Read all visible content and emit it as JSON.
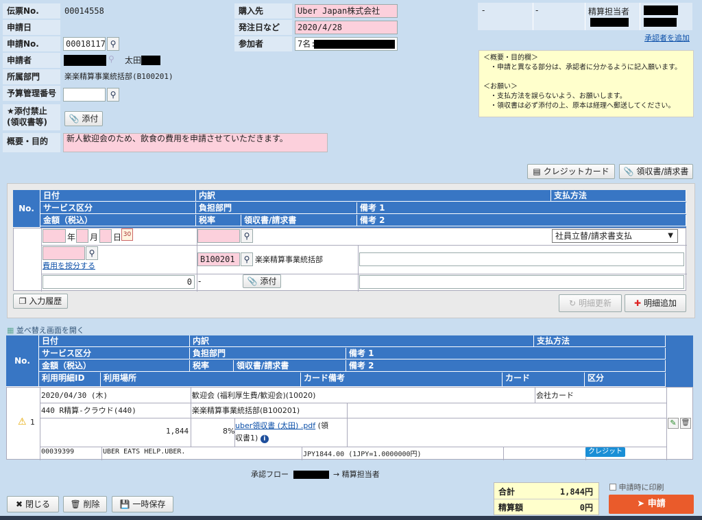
{
  "header": {
    "denpyo_label": "伝票No.",
    "denpyo_value": "00014558",
    "shinseibi_label": "申請日",
    "shinsei_no_label": "申請No.",
    "shinsei_no_value": "00018117",
    "shinseisha_label": "申請者",
    "shinseisha_name": "太田",
    "busho_label": "所属部門",
    "busho_value": "楽楽精算事業統括部(B100201)",
    "yosan_label": "予算管理番号",
    "tenpu_label_1": "★添付禁止",
    "tenpu_label_2": "(領収書等)",
    "tenpu_button": "添付",
    "gaiyo_label": "概要・目的",
    "gaiyo_value": "新人歓迎会のため、飲食の費用を申請させていただきます。",
    "konyusaki_label": "購入先",
    "konyusaki_value": "Uber Japan株式会社",
    "hacchubi_label": "発注日など",
    "hacchubi_value": "2020/4/28",
    "sankasha_label": "参加者",
    "sankasha_value": "7名:"
  },
  "approval": {
    "col1": "-",
    "col2": "-",
    "seisan_tanto": "精算担当者",
    "add_approver": "承認者を追加"
  },
  "notes": {
    "text": "＜概要・目的欄＞\n　・申請と異なる部分は、承認者に分かるように記入願います。\n\n＜お願い＞\n　・支払方法を誤らないよう、お願いします。\n　・領収書は必ず添付の上、原本は経理へ郵送してください。"
  },
  "top_buttons": {
    "credit_card": "クレジットカード",
    "receipt": "領収書/請求書"
  },
  "entry_table": {
    "no": "No.",
    "h_date": "日付",
    "h_service": "サービス区分",
    "h_amount": "金額（税込）",
    "h_uchiwake": "内訳",
    "h_futan": "負担部門",
    "h_zeiritsu": "税率",
    "h_ryoshusho": "領収書/請求書",
    "h_biko1": "備考 1",
    "h_biko2": "備考 2",
    "h_shiharai": "支払方法",
    "year_label": "年",
    "month_label": "月",
    "day_label": "日",
    "calendar": "30",
    "shiharai_value": "社員立替/請求書支払",
    "anbun_link": "費用を按分する",
    "futan_code": "B100201",
    "futan_name": "楽楽精算事業統括部",
    "amount_value": "0",
    "zeiritsu_value": "-",
    "tenpu_button": "添付",
    "history_button": "入力履歴",
    "update_button": "明細更新",
    "add_button": "明細追加"
  },
  "sort_link": "並べ替え画面を開く",
  "list_table": {
    "no": "No.",
    "h_date": "日付",
    "h_service": "サービス区分",
    "h_amount": "金額（税込）",
    "h_meisai_id": "利用明細ID",
    "h_basho": "利用場所",
    "h_uchiwake": "内訳",
    "h_futan": "負担部門",
    "h_zeiritsu": "税率",
    "h_ryoshusho": "領収書/請求書",
    "h_biko1": "備考 1",
    "h_biko2": "備考 2",
    "h_card_biko": "カード備考",
    "h_shiharai": "支払方法",
    "h_card": "カード",
    "h_kubun": "区分",
    "row": {
      "no": "1",
      "date": "2020/04/30 (木)",
      "uchiwake": "歓迎会 (福利厚生費/歓迎会)(10020)",
      "shiharai": "会社カード",
      "service": "440 R精算-クラウド(440)",
      "futan": "楽楽精算事業統括部(B100201)",
      "amount": "1,844",
      "zeiritsu": "8%",
      "ryoshusho_link": "uber領収書 (太田) .pdf",
      "ryoshusho_suffix_1": "(領",
      "ryoshusho_suffix_2": "収書1)",
      "meisai_id": "00039399",
      "basho": "UBER EATS HELP.UBER.",
      "card_biko": "JPY1844.00 (1JPY=1.0000000円)",
      "kubun": "クレジット"
    }
  },
  "flow": {
    "label": "承認フロー",
    "arrow": "→",
    "seisan": "精算担当者"
  },
  "footer": {
    "close": "閉じる",
    "delete": "削除",
    "save": "一時保存",
    "total_label": "合計",
    "total_value": "1,844円",
    "seisan_label": "精算額",
    "seisan_value": "0円",
    "print_label": "申請時に印刷",
    "submit": "申請"
  },
  "colors": {
    "background": "#c9ddf0",
    "table_header": "#3876c4",
    "pink_field": "#fcd0dc",
    "submit": "#ea5b2b",
    "badge": "#1a8fd6"
  }
}
